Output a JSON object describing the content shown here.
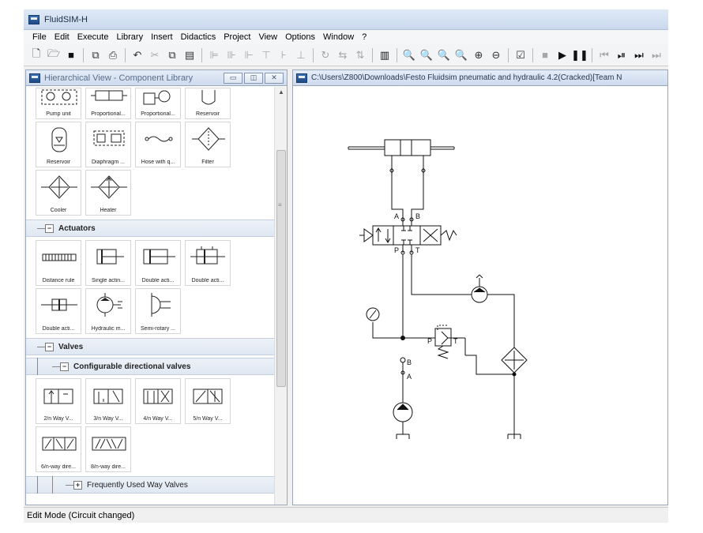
{
  "window": {
    "title": "FluidSIM-H"
  },
  "menu": [
    "File",
    "Edit",
    "Execute",
    "Library",
    "Insert",
    "Didactics",
    "Project",
    "View",
    "Options",
    "Window",
    "?"
  ],
  "library_panel": {
    "title": "Hierarchical View - Component Library",
    "top_row": [
      "Pump unit",
      "Proportional...",
      "Proportional...",
      "Reservoir"
    ],
    "row2": [
      "Reservoir",
      "Diaphragm ...",
      "Hose with q...",
      "Filter"
    ],
    "row3": [
      "Cooler",
      "Heater"
    ],
    "sections": {
      "actuators": "Actuators",
      "valves": "Valves",
      "configurable": "Configurable directional valves",
      "frequent": "Frequently Used Way Valves"
    },
    "actuators": [
      "Distance rule",
      "Single actin...",
      "Double acti...",
      "Double acti...",
      "Double acti...",
      "Hydraulic m...",
      "Semi-rotary ..."
    ],
    "configurable": [
      "2/n Way V...",
      "3/n Way V...",
      "4/n Way V...",
      "5/n Way V...",
      "6/n-way dire...",
      "8/n-way dire..."
    ]
  },
  "circuit_panel": {
    "title": "C:\\Users\\Z800\\Downloads\\Festo Fluidsim pneumatic and hydraulic 4.2(Cracked)[Team N",
    "port_labels": {
      "A": "A",
      "B": "B",
      "P": "P",
      "T": "T",
      "relief_P": "P",
      "relief_T": "T",
      "lower_B": "B",
      "lower_A": "A"
    }
  },
  "status": "Edit Mode (Circuit changed)",
  "colors": {
    "title_gradient_top": "#dfe9f5",
    "panel_header": "#cedbee",
    "section_bg": "#dfe7f2"
  }
}
